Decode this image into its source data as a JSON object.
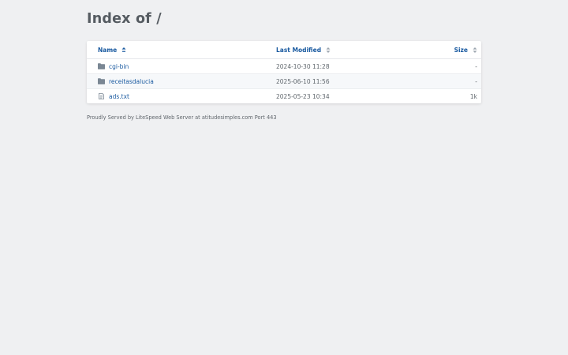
{
  "page": {
    "title": "Index of /"
  },
  "table": {
    "headers": {
      "name": "Name",
      "last_modified": "Last Modified",
      "size": "Size"
    },
    "rows": [
      {
        "name": "cgi-bin",
        "type": "folder-icon",
        "modified": "2024-10-30 11:28",
        "size": "-"
      },
      {
        "name": "receitasdalucia",
        "type": "folder-icon",
        "modified": "2025-06-10 11:56",
        "size": "-"
      },
      {
        "name": "ads.txt",
        "type": "file-icon",
        "modified": "2025-05-23 10:34",
        "size": "1k"
      }
    ]
  },
  "footer": {
    "text": "Proudly Served by LiteSpeed Web Server at atitudesimples.com Port 443"
  },
  "colors": {
    "background": "#eff0f2",
    "link": "#1a5aa0",
    "icon": "#7a8794"
  }
}
